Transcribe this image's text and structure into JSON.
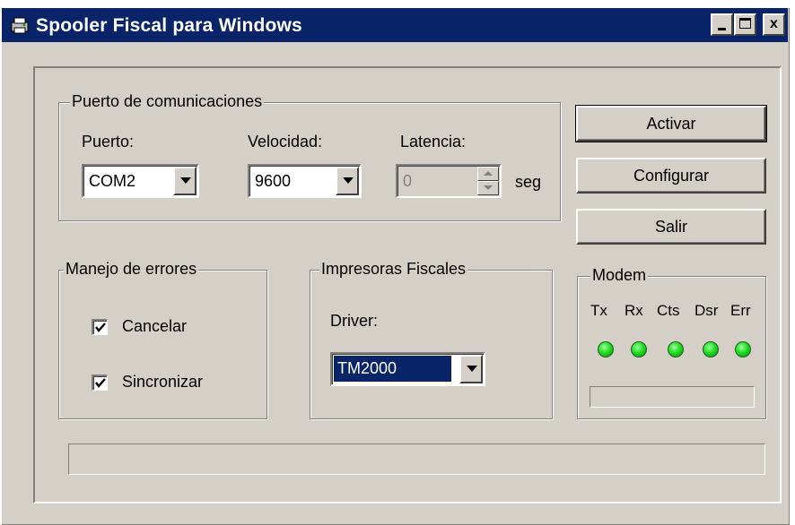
{
  "window": {
    "title": "Spooler Fiscal para Windows",
    "title_bar_color": "#0a246a",
    "buttons": [
      "minimize-icon",
      "maximize-icon",
      "close-icon"
    ],
    "close_glyph": "x"
  },
  "comm": {
    "legend": "Puerto de comunicaciones",
    "port_label": "Puerto:",
    "port_value": "COM2",
    "speed_label": "Velocidad:",
    "speed_value": "9600",
    "latency_label": "Latencia:",
    "latency_value": "0",
    "latency_unit": "seg"
  },
  "actions": {
    "activate": "Activar",
    "configure": "Configurar",
    "exit": "Salir"
  },
  "errors": {
    "legend": "Manejo de errores",
    "cancel_label": "Cancelar",
    "cancel_checked": true,
    "sync_label": "Sincronizar",
    "sync_checked": true
  },
  "printers": {
    "legend": "Impresoras Fiscales",
    "driver_label": "Driver:",
    "driver_value": "TM2000",
    "selection_color": "#0a246a"
  },
  "modem": {
    "legend": "Modem",
    "indicators": [
      "Tx",
      "Rx",
      "Cts",
      "Dsr",
      "Err"
    ],
    "led_color": "#22dd22"
  }
}
